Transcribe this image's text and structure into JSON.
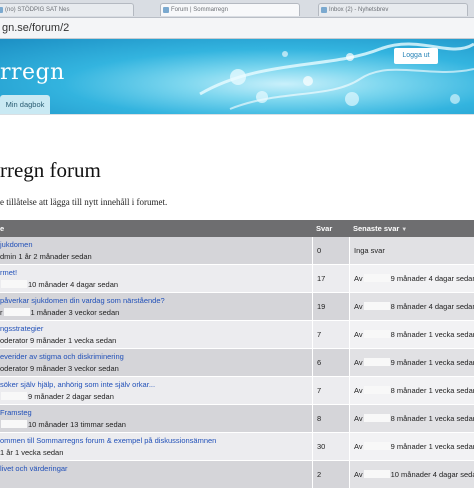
{
  "browser": {
    "tabs": [
      {
        "label": "(no) STÖDPIG SAT Nes",
        "active": false
      },
      {
        "label": "Forum | Sommarregn",
        "active": true
      },
      {
        "label": "Inbox (2) - Nyhetsbrev",
        "active": false
      }
    ],
    "url": "gn.se/forum/2"
  },
  "header": {
    "site_name": "rregn",
    "login_label": "Logga ut",
    "nav_tab_label": "Min dagbok"
  },
  "page": {
    "title": "rregn forum",
    "notice": "e tillåtelse att lägga till nytt innehåll i forumet."
  },
  "table": {
    "headers": {
      "topic": "e",
      "replies": "Svar",
      "last_reply": "Senaste svar"
    },
    "rows": [
      {
        "topic": "jukdomen",
        "meta": "dmin 1 år 2 månader sedan",
        "meta_prefix": "",
        "replies": "0",
        "last_prefix": "",
        "last": "Inga svar"
      },
      {
        "topic": "rmet!",
        "meta": "10 månader 4 dagar sedan",
        "meta_prefix": "",
        "replies": "17",
        "last_prefix": "Av",
        "last": "9 månader 4 dagar sedan"
      },
      {
        "topic": "påverkar sjukdomen din vardag som närstående?",
        "meta": "1 månader 3 veckor sedan",
        "meta_prefix": "r",
        "replies": "19",
        "last_prefix": "Av",
        "last": "8 månader 4 dagar sedan"
      },
      {
        "topic": "ngsstrategier",
        "meta": "oderator 9 månader 1 vecka sedan",
        "meta_prefix": "",
        "replies": "7",
        "last_prefix": "Av",
        "last": "8 månader 1 vecka sedan"
      },
      {
        "topic": "everider av stigma och diskriminering",
        "meta": "oderator 9 månader 3 veckor sedan",
        "meta_prefix": "",
        "replies": "6",
        "last_prefix": "Av",
        "last": "9 månader 1 vecka sedan"
      },
      {
        "topic": "söker själv hjälp, anhörig som inte själv orkar...",
        "meta": "9 månader 2 dagar sedan",
        "meta_prefix": "",
        "replies": "7",
        "last_prefix": "Av",
        "last": "8 månader 1 vecka sedan"
      },
      {
        "topic": "Framsteg",
        "meta": "10 månader 13 timmar sedan",
        "meta_prefix": "",
        "replies": "8",
        "last_prefix": "Av",
        "last": "8 månader 1 vecka sedan"
      },
      {
        "topic": "ommen till Sommarregns forum & exempel på diskussionsämnen",
        "meta": "1 år 1 vecka sedan",
        "meta_prefix": "",
        "replies": "30",
        "last_prefix": "Av",
        "last": "9 månader 1 vecka sedan"
      },
      {
        "topic": "livet och värderingar",
        "meta": "",
        "meta_prefix": "",
        "replies": "2",
        "last_prefix": "Av",
        "last": "10 månader 4 dagar sedan"
      }
    ]
  },
  "colors": {
    "link": "#2150b8",
    "table_header": "#6e6e70",
    "login_text": "#1f7fb5"
  }
}
